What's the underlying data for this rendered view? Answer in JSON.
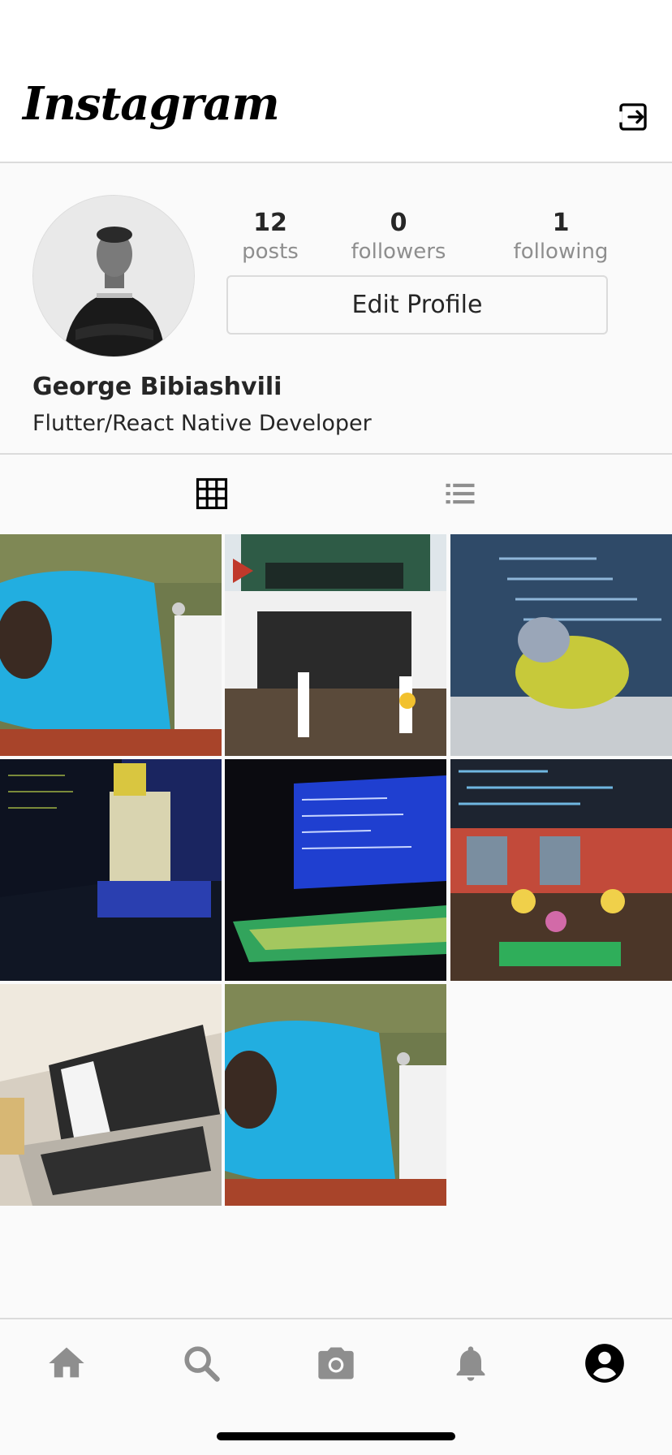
{
  "header": {
    "logo_text": "Instagram",
    "logout_icon": "logout-icon"
  },
  "profile": {
    "stats": {
      "posts_count": "12",
      "posts_label": "posts",
      "followers_count": "0",
      "followers_label": "followers",
      "following_count": "1",
      "following_label": "following"
    },
    "edit_button_label": "Edit Profile",
    "name": "George Bibiashvili",
    "bio": "Flutter/React Native Developer"
  },
  "tabs": [
    {
      "icon": "grid-icon",
      "active": true
    },
    {
      "icon": "list-icon",
      "active": false
    }
  ],
  "posts": [
    {
      "subject": "man in blue hoodie with laptop on grass",
      "colors": [
        "#6f7a4c",
        "#22aee0",
        "#f2f2f2"
      ]
    },
    {
      "subject": "hotel restaurant building with person sitting",
      "colors": [
        "#dfe6ea",
        "#2b2b2b",
        "#8a7a62"
      ]
    },
    {
      "subject": "parakeet on laptop with code",
      "colors": [
        "#2f4a68",
        "#c7c93a",
        "#5f7d9a"
      ]
    },
    {
      "subject": "curved monitor and rgb keyboard",
      "colors": [
        "#101624",
        "#2a3fb0",
        "#d9c640"
      ]
    },
    {
      "subject": "laptop with glowing keyboard",
      "colors": [
        "#0b0b10",
        "#1f3fd0",
        "#39c06a"
      ]
    },
    {
      "subject": "lego cafe figures with code screen",
      "colors": [
        "#1d2430",
        "#c24a3a",
        "#f0d04a"
      ]
    },
    {
      "subject": "laptop with code in tent",
      "colors": [
        "#d7cfc2",
        "#2b2b2b",
        "#b8b2a8"
      ]
    },
    {
      "subject": "man in blue hoodie with laptop on grass",
      "colors": [
        "#6f7a4c",
        "#22aee0",
        "#f2f2f2"
      ]
    }
  ],
  "bottom_nav": [
    {
      "icon": "home-icon",
      "active": false
    },
    {
      "icon": "search-icon",
      "active": false
    },
    {
      "icon": "camera-icon",
      "active": false
    },
    {
      "icon": "bell-icon",
      "active": false
    },
    {
      "icon": "profile-icon",
      "active": true
    }
  ],
  "colors": {
    "divider": "#dbdbdb",
    "muted_text": "#8e8e8e",
    "inactive_icon": "#8e8e8e",
    "active_icon": "#000000"
  }
}
